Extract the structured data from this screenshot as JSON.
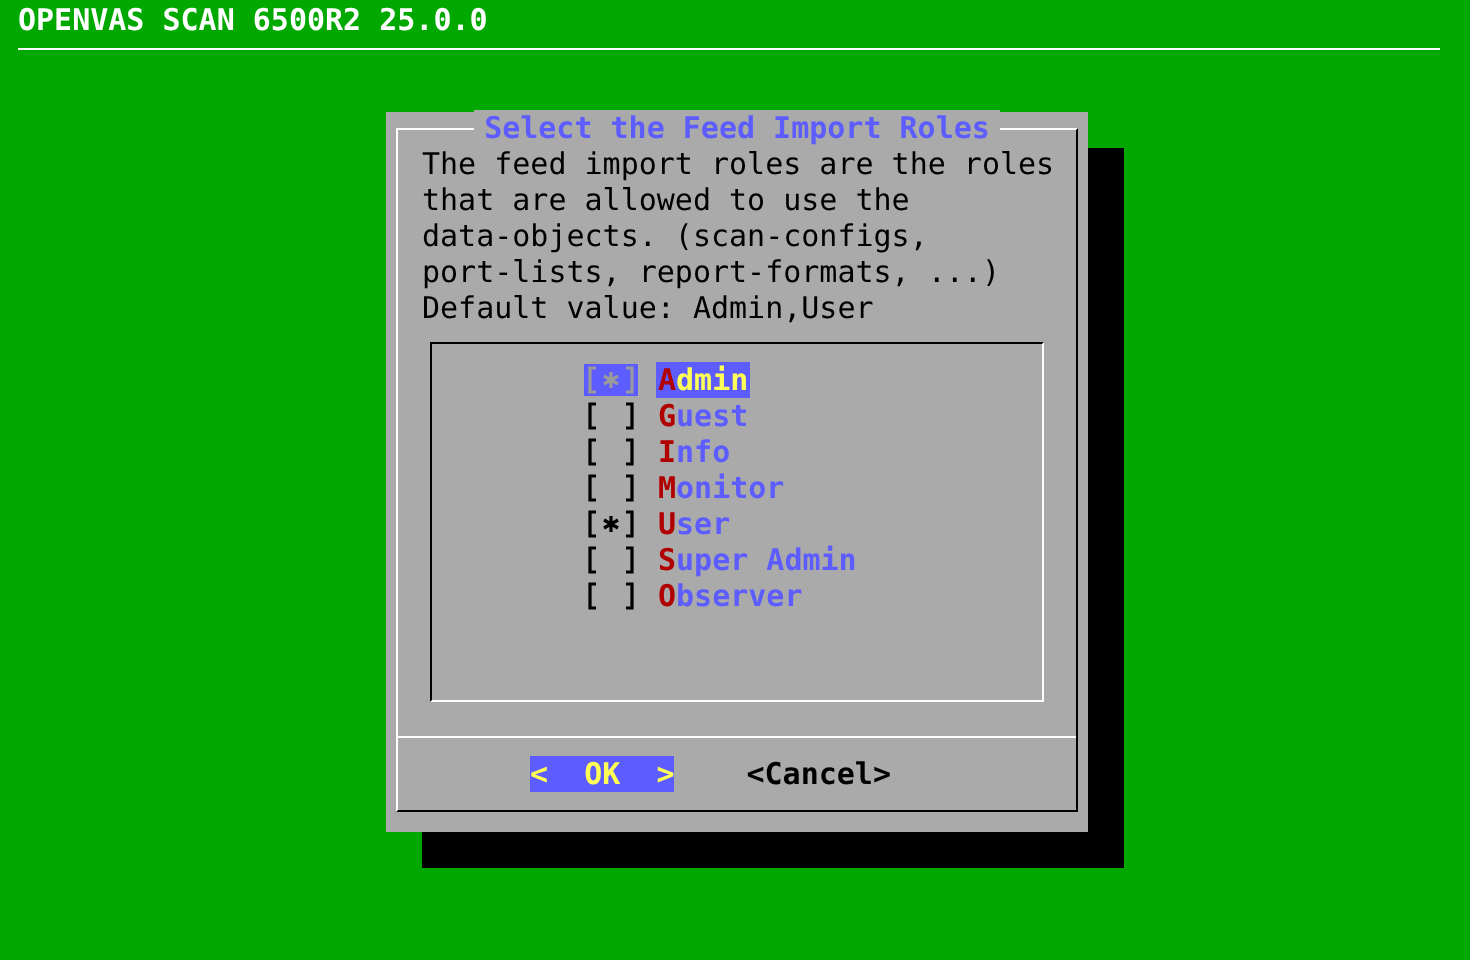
{
  "backtitle": "OPENVAS SCAN 6500R2 25.0.0",
  "dialog": {
    "title": "Select the Feed Import Roles",
    "message": [
      "The feed import roles are the roles",
      "that are allowed to use the",
      "data-objects. (scan-configs,",
      "port-lists, report-formats, ...)",
      "Default value: Admin,User"
    ],
    "items": [
      {
        "label": "Admin",
        "checked": true,
        "selected": true
      },
      {
        "label": "Guest",
        "checked": false,
        "selected": false
      },
      {
        "label": "Info",
        "checked": false,
        "selected": false
      },
      {
        "label": "Monitor",
        "checked": false,
        "selected": false
      },
      {
        "label": "User",
        "checked": true,
        "selected": false
      },
      {
        "label": "Super Admin",
        "checked": false,
        "selected": false
      },
      {
        "label": "Observer",
        "checked": false,
        "selected": false
      }
    ],
    "buttons": [
      {
        "label": "<  OK  >",
        "selected": true
      },
      {
        "label": "<Cancel>",
        "selected": false
      }
    ]
  }
}
